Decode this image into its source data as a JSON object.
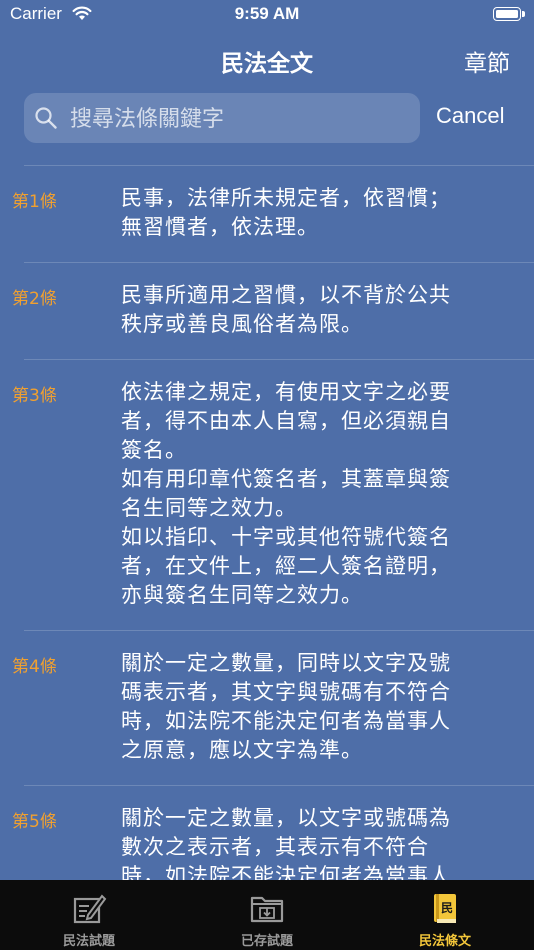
{
  "status_bar": {
    "carrier": "Carrier",
    "time": "9:59 AM"
  },
  "nav": {
    "title": "民法全文",
    "chapter_button": "章節"
  },
  "search": {
    "placeholder": "搜尋法條關鍵字",
    "value": "",
    "cancel_label": "Cancel"
  },
  "articles": [
    {
      "number": "第1條",
      "text": "民事，法律所未規定者，依習慣；\n無習慣者，依法理。"
    },
    {
      "number": "第2條",
      "text": "民事所適用之習慣，以不背於公共\n秩序或善良風俗者為限。"
    },
    {
      "number": "第3條",
      "text": "依法律之規定，有使用文字之必要\n者，得不由本人自寫，但必須親自\n簽名。\n如有用印章代簽名者，其蓋章與簽\n名生同等之效力。\n如以指印、十字或其他符號代簽名\n者，在文件上，經二人簽名證明，\n亦與簽名生同等之效力。"
    },
    {
      "number": "第4條",
      "text": "關於一定之數量，同時以文字及號\n碼表示者，其文字與號碼有不符合\n時，如法院不能決定何者為當事人\n之原意，應以文字為準。"
    },
    {
      "number": "第5條",
      "text": "關於一定之數量，以文字或號碼為\n數次之表示者，其表示有不符合\n時，如法院不能決定何者為當事人\n之原意，應以最低額為準。"
    }
  ],
  "tab_bar": {
    "tabs": [
      {
        "label": "民法試題",
        "icon": "edit-note-icon",
        "active": false
      },
      {
        "label": "已存試題",
        "icon": "saved-folder-icon",
        "active": false
      },
      {
        "label": "民法條文",
        "icon": "law-book-icon",
        "active": true,
        "icon_text": "民"
      }
    ]
  },
  "colors": {
    "background": "#4e6ea8",
    "article_number": "#f0a030",
    "tab_active": "#f3c63a",
    "tab_inactive": "#9a9a9a",
    "tab_bar": "#0c0c0c"
  }
}
